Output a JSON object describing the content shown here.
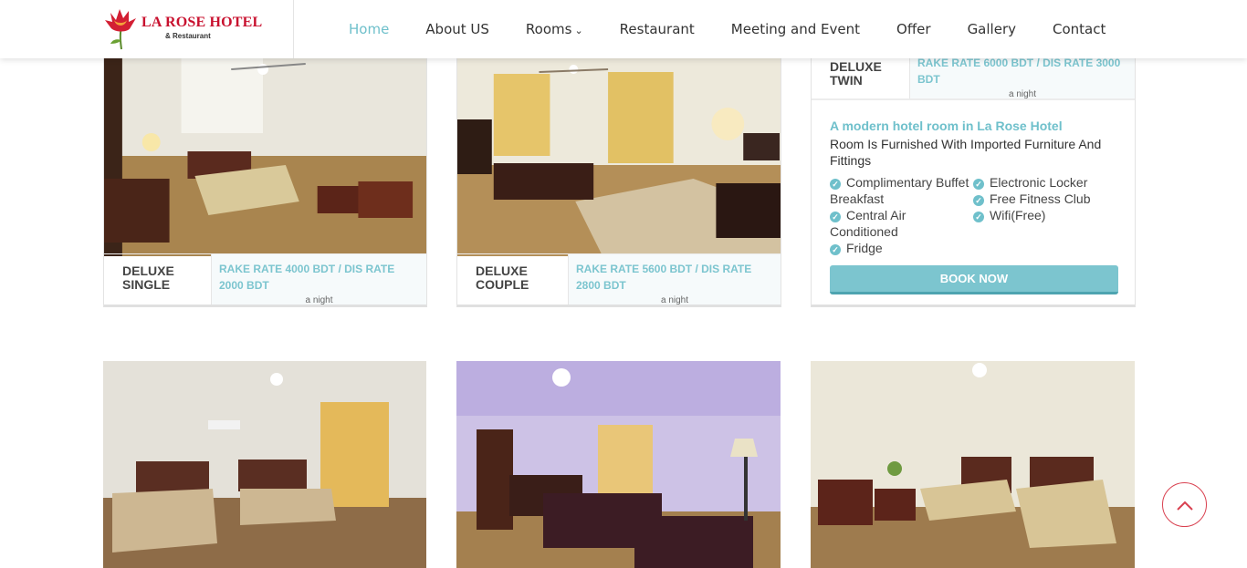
{
  "brand": {
    "name": "LA ROSE HOTEL",
    "tagline": "& Restaurant"
  },
  "nav": {
    "items": [
      {
        "label": "Home",
        "active": true
      },
      {
        "label": "About US",
        "active": false
      },
      {
        "label": "Rooms",
        "active": false,
        "dropdown": true
      },
      {
        "label": "Restaurant",
        "active": false
      },
      {
        "label": "Meeting and Event",
        "active": false
      },
      {
        "label": "Offer",
        "active": false
      },
      {
        "label": "Gallery",
        "active": false
      },
      {
        "label": "Contact",
        "active": false
      }
    ]
  },
  "rooms": [
    {
      "name_line1": "DELUXE",
      "name_line2": "SINGLE",
      "rate": "RAKE RATE 4000 BDT / DIS RATE 2000 BDT",
      "per": "a night"
    },
    {
      "name_line1": "DELUXE",
      "name_line2": "COUPLE",
      "rate": "RAKE RATE 5600 BDT / DIS RATE 2800 BDT",
      "per": "a night"
    },
    {
      "name_line1": "DELUXE",
      "name_line2": "TWIN",
      "rate": "RAKE RATE 6000 BDT / DIS RATE 3000 BDT",
      "per": "a night",
      "detail_title": "A modern hotel room in La Rose Hotel",
      "detail_desc": "Room Is Furnished With Imported Furniture And Fittings",
      "features_left": [
        "Complimentary Buffet Breakfast",
        "Central Air Conditioned",
        "Fridge"
      ],
      "features_right": [
        "Electronic Locker",
        "Free Fitness Club",
        "Wifi(Free)"
      ],
      "book_label": "BOOK NOW"
    }
  ],
  "icons": {
    "scroll_top": "chevron-up-icon",
    "feature": "check-circle-icon",
    "logo": "rose-flower-icon"
  },
  "colors": {
    "accent": "#6fc0cb",
    "brand_red": "#c8102e",
    "button": "#7cc5cf"
  }
}
